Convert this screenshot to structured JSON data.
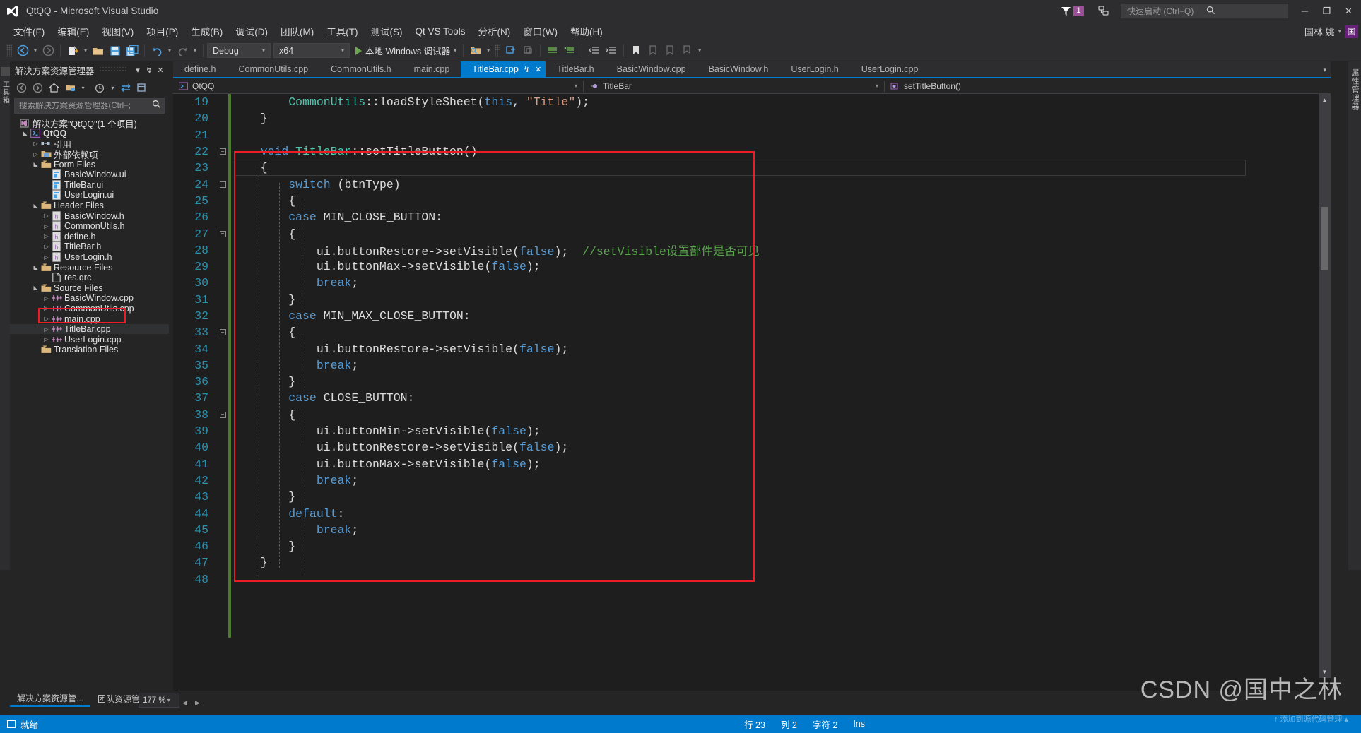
{
  "window": {
    "title": "QtQQ - Microsoft Visual Studio",
    "minimize_label": "─",
    "restore_label": "❐",
    "close_label": "✕"
  },
  "titlebar": {
    "notification_count": "1",
    "quick_launch_placeholder": "快速启动 (Ctrl+Q)",
    "quick_launch_value": "",
    "search_icon": "search-icon",
    "flag_icon": "flag-icon",
    "feedback_icon": "feedback-icon"
  },
  "user": {
    "name": "国林 姚",
    "avatar_letter": "国",
    "caret": "▾"
  },
  "menu": {
    "items": [
      "文件(F)",
      "编辑(E)",
      "视图(V)",
      "项目(P)",
      "生成(B)",
      "调试(D)",
      "团队(M)",
      "工具(T)",
      "测试(S)",
      "Qt VS Tools",
      "分析(N)",
      "窗口(W)",
      "帮助(H)"
    ]
  },
  "toolbar": {
    "nav_back": "←",
    "nav_forward": "→",
    "new_project": "new-project-icon",
    "open_file": "open-file-icon",
    "save": "save-icon",
    "save_all": "save-all-icon",
    "undo": "↶",
    "redo": "↷",
    "config": "Debug",
    "platform": "x64",
    "run_label": "本地 Windows 调试器",
    "caret": "▾"
  },
  "solution_explorer": {
    "title": "解决方案资源管理器",
    "header_buttons": [
      "▾",
      "↯",
      "✕"
    ],
    "toolbar_icons": [
      "back-icon",
      "forward-icon",
      "home-icon",
      "show-all-files-icon",
      "caret-icon",
      "pending-changes-icon",
      "caret-icon",
      "sync-icon",
      "properties-icon"
    ],
    "search_placeholder": "搜索解决方案资源管理器(Ctrl+;",
    "search_value": "",
    "tree": [
      {
        "label": "解决方案\"QtQQ\"(1 个项目)",
        "depth": 0,
        "twist": "",
        "icon": "solution-icon",
        "bold": false
      },
      {
        "label": "QtQQ",
        "depth": 1,
        "twist": "open",
        "icon": "project-icon",
        "bold": true
      },
      {
        "label": "引用",
        "depth": 2,
        "twist": "closed",
        "icon": "references-icon",
        "bold": false
      },
      {
        "label": "外部依赖项",
        "depth": 2,
        "twist": "closed",
        "icon": "folder-icon",
        "bold": false
      },
      {
        "label": "Form Files",
        "depth": 2,
        "twist": "open",
        "icon": "filter-folder-icon",
        "bold": false
      },
      {
        "label": "BasicWindow.ui",
        "depth": 3,
        "twist": "",
        "icon": "ui-file-icon",
        "bold": false
      },
      {
        "label": "TitleBar.ui",
        "depth": 3,
        "twist": "",
        "icon": "ui-file-icon",
        "bold": false
      },
      {
        "label": "UserLogin.ui",
        "depth": 3,
        "twist": "",
        "icon": "ui-file-icon",
        "bold": false
      },
      {
        "label": "Header Files",
        "depth": 2,
        "twist": "open",
        "icon": "filter-folder-icon",
        "bold": false
      },
      {
        "label": "BasicWindow.h",
        "depth": 3,
        "twist": "closed",
        "icon": "h-file-icon",
        "bold": false
      },
      {
        "label": "CommonUtils.h",
        "depth": 3,
        "twist": "closed",
        "icon": "h-file-icon",
        "bold": false
      },
      {
        "label": "define.h",
        "depth": 3,
        "twist": "closed",
        "icon": "h-file-icon",
        "bold": false
      },
      {
        "label": "TitleBar.h",
        "depth": 3,
        "twist": "closed",
        "icon": "h-file-icon",
        "bold": false
      },
      {
        "label": "UserLogin.h",
        "depth": 3,
        "twist": "closed",
        "icon": "h-file-icon",
        "bold": false
      },
      {
        "label": "Resource Files",
        "depth": 2,
        "twist": "open",
        "icon": "filter-folder-icon",
        "bold": false
      },
      {
        "label": "res.qrc",
        "depth": 3,
        "twist": "",
        "icon": "qrc-file-icon",
        "bold": false
      },
      {
        "label": "Source Files",
        "depth": 2,
        "twist": "open",
        "icon": "filter-folder-icon",
        "bold": false
      },
      {
        "label": "BasicWindow.cpp",
        "depth": 3,
        "twist": "closed",
        "icon": "cpp-file-icon",
        "bold": false
      },
      {
        "label": "CommonUtils.cpp",
        "depth": 3,
        "twist": "closed",
        "icon": "cpp-file-icon",
        "bold": false
      },
      {
        "label": "main.cpp",
        "depth": 3,
        "twist": "closed",
        "icon": "cpp-file-icon",
        "bold": false
      },
      {
        "label": "TitleBar.cpp",
        "depth": 3,
        "twist": "closed",
        "icon": "cpp-file-icon",
        "bold": false,
        "highlighted": true
      },
      {
        "label": "UserLogin.cpp",
        "depth": 3,
        "twist": "closed",
        "icon": "cpp-file-icon",
        "bold": false
      },
      {
        "label": "Translation Files",
        "depth": 2,
        "twist": "",
        "icon": "filter-folder-icon",
        "bold": false
      }
    ]
  },
  "editor": {
    "tabs": [
      {
        "label": "define.h",
        "active": false
      },
      {
        "label": "CommonUtils.cpp",
        "active": false
      },
      {
        "label": "CommonUtils.h",
        "active": false
      },
      {
        "label": "main.cpp",
        "active": false
      },
      {
        "label": "TitleBar.cpp",
        "active": true
      },
      {
        "label": "TitleBar.h",
        "active": false
      },
      {
        "label": "BasicWindow.cpp",
        "active": false
      },
      {
        "label": "BasicWindow.h",
        "active": false
      },
      {
        "label": "UserLogin.h",
        "active": false
      },
      {
        "label": "UserLogin.cpp",
        "active": false
      }
    ],
    "tab_pin_icon": "↯",
    "tab_close_icon": "✕",
    "navbar": {
      "project": "QtQQ",
      "class": "TitleBar",
      "member": "setTitleButton()",
      "caret": "▾"
    },
    "lines": [
      {
        "num": "19",
        "fold": "",
        "tokens": [
          {
            "t": "        ",
            "c": "pln"
          },
          {
            "t": "CommonUtils",
            "c": "typ"
          },
          {
            "t": "::",
            "c": "pln"
          },
          {
            "t": "loadStyleSheet",
            "c": "pln"
          },
          {
            "t": "(",
            "c": "pln"
          },
          {
            "t": "this",
            "c": "kw"
          },
          {
            "t": ", ",
            "c": "pln"
          },
          {
            "t": "\"Title\"",
            "c": "str"
          },
          {
            "t": ");",
            "c": "pln"
          }
        ]
      },
      {
        "num": "20",
        "fold": "",
        "tokens": [
          {
            "t": "    }",
            "c": "pln"
          }
        ]
      },
      {
        "num": "21",
        "fold": "",
        "tokens": []
      },
      {
        "num": "22",
        "fold": "minus",
        "tokens": [
          {
            "t": "    ",
            "c": "pln"
          },
          {
            "t": "void ",
            "c": "kw"
          },
          {
            "t": "TitleBar",
            "c": "typ"
          },
          {
            "t": "::",
            "c": "pln"
          },
          {
            "t": "setTitleButton",
            "c": "pln"
          },
          {
            "t": "()",
            "c": "pln"
          }
        ]
      },
      {
        "num": "23",
        "fold": "",
        "tokens": [
          {
            "t": "    {",
            "c": "pln"
          }
        ]
      },
      {
        "num": "24",
        "fold": "minus",
        "tokens": [
          {
            "t": "        ",
            "c": "pln"
          },
          {
            "t": "switch",
            "c": "kw"
          },
          {
            "t": " (btnType)",
            "c": "pln"
          }
        ]
      },
      {
        "num": "25",
        "fold": "",
        "tokens": [
          {
            "t": "        {",
            "c": "pln"
          }
        ]
      },
      {
        "num": "26",
        "fold": "",
        "tokens": [
          {
            "t": "        ",
            "c": "pln"
          },
          {
            "t": "case",
            "c": "kw"
          },
          {
            "t": " MIN_CLOSE_BUTTON:",
            "c": "pln"
          }
        ]
      },
      {
        "num": "27",
        "fold": "minus",
        "tokens": [
          {
            "t": "        {",
            "c": "pln"
          }
        ]
      },
      {
        "num": "28",
        "fold": "",
        "tokens": [
          {
            "t": "            ui.buttonRestore->setVisible(",
            "c": "pln"
          },
          {
            "t": "false",
            "c": "kw"
          },
          {
            "t": ");  ",
            "c": "pln"
          },
          {
            "t": "//setVisible设置部件是否可见",
            "c": "cmt"
          }
        ]
      },
      {
        "num": "29",
        "fold": "",
        "tokens": [
          {
            "t": "            ui.buttonMax->setVisible(",
            "c": "pln"
          },
          {
            "t": "false",
            "c": "kw"
          },
          {
            "t": ");",
            "c": "pln"
          }
        ]
      },
      {
        "num": "30",
        "fold": "",
        "tokens": [
          {
            "t": "            ",
            "c": "pln"
          },
          {
            "t": "break",
            "c": "kw"
          },
          {
            "t": ";",
            "c": "pln"
          }
        ]
      },
      {
        "num": "31",
        "fold": "",
        "tokens": [
          {
            "t": "        }",
            "c": "pln"
          }
        ]
      },
      {
        "num": "32",
        "fold": "",
        "tokens": [
          {
            "t": "        ",
            "c": "pln"
          },
          {
            "t": "case",
            "c": "kw"
          },
          {
            "t": " MIN_MAX_CLOSE_BUTTON:",
            "c": "pln"
          }
        ]
      },
      {
        "num": "33",
        "fold": "minus",
        "tokens": [
          {
            "t": "        {",
            "c": "pln"
          }
        ]
      },
      {
        "num": "34",
        "fold": "",
        "tokens": [
          {
            "t": "            ui.buttonRestore->setVisible(",
            "c": "pln"
          },
          {
            "t": "false",
            "c": "kw"
          },
          {
            "t": ");",
            "c": "pln"
          }
        ]
      },
      {
        "num": "35",
        "fold": "",
        "tokens": [
          {
            "t": "            ",
            "c": "pln"
          },
          {
            "t": "break",
            "c": "kw"
          },
          {
            "t": ";",
            "c": "pln"
          }
        ]
      },
      {
        "num": "36",
        "fold": "",
        "tokens": [
          {
            "t": "        }",
            "c": "pln"
          }
        ]
      },
      {
        "num": "37",
        "fold": "",
        "tokens": [
          {
            "t": "        ",
            "c": "pln"
          },
          {
            "t": "case",
            "c": "kw"
          },
          {
            "t": " CLOSE_BUTTON:",
            "c": "pln"
          }
        ]
      },
      {
        "num": "38",
        "fold": "minus",
        "tokens": [
          {
            "t": "        {",
            "c": "pln"
          }
        ]
      },
      {
        "num": "39",
        "fold": "",
        "tokens": [
          {
            "t": "            ui.buttonMin->setVisible(",
            "c": "pln"
          },
          {
            "t": "false",
            "c": "kw"
          },
          {
            "t": ");",
            "c": "pln"
          }
        ]
      },
      {
        "num": "40",
        "fold": "",
        "tokens": [
          {
            "t": "            ui.buttonRestore->setVisible(",
            "c": "pln"
          },
          {
            "t": "false",
            "c": "kw"
          },
          {
            "t": ");",
            "c": "pln"
          }
        ]
      },
      {
        "num": "41",
        "fold": "",
        "tokens": [
          {
            "t": "            ui.buttonMax->setVisible(",
            "c": "pln"
          },
          {
            "t": "false",
            "c": "kw"
          },
          {
            "t": ");",
            "c": "pln"
          }
        ]
      },
      {
        "num": "42",
        "fold": "",
        "tokens": [
          {
            "t": "            ",
            "c": "pln"
          },
          {
            "t": "break",
            "c": "kw"
          },
          {
            "t": ";",
            "c": "pln"
          }
        ]
      },
      {
        "num": "43",
        "fold": "",
        "tokens": [
          {
            "t": "        }",
            "c": "pln"
          }
        ]
      },
      {
        "num": "44",
        "fold": "",
        "tokens": [
          {
            "t": "        ",
            "c": "pln"
          },
          {
            "t": "default",
            "c": "kw"
          },
          {
            "t": ":",
            "c": "pln"
          }
        ]
      },
      {
        "num": "45",
        "fold": "",
        "tokens": [
          {
            "t": "            ",
            "c": "pln"
          },
          {
            "t": "break",
            "c": "kw"
          },
          {
            "t": ";",
            "c": "pln"
          }
        ]
      },
      {
        "num": "46",
        "fold": "",
        "tokens": [
          {
            "t": "        }",
            "c": "pln"
          }
        ]
      },
      {
        "num": "47",
        "fold": "",
        "tokens": [
          {
            "t": "    }",
            "c": "pln"
          }
        ]
      },
      {
        "num": "48",
        "fold": "",
        "tokens": []
      }
    ]
  },
  "bottom_dock": {
    "tabs": [
      {
        "label": "解决方案资源管...",
        "selected": true
      },
      {
        "label": "团队资源管理器",
        "selected": false
      }
    ],
    "zoom_level": "177 %",
    "zoom_caret": "▾",
    "hscroll_left": "◀",
    "hscroll_right": "▶"
  },
  "statusbar": {
    "ready": "就绪",
    "line_label": "行 23",
    "col_label": "列 2",
    "char_label": "字符 2",
    "insert_label": "Ins"
  },
  "watermark": {
    "text": "CSDN @国中之林",
    "subtext": "↑ 添加到源代码管理 ▴"
  },
  "rails": {
    "left": "工具箱",
    "right": "属性管理器"
  },
  "colors": {
    "accent": "#007acc",
    "annotation_red": "#ee1c25",
    "purple_badge": "#68217a",
    "keyword_blue": "#569cd6",
    "comment_green": "#57a64a",
    "string_orange": "#d69d85",
    "type_teal": "#4ec9b0",
    "linenum_blue": "#2b91af"
  }
}
